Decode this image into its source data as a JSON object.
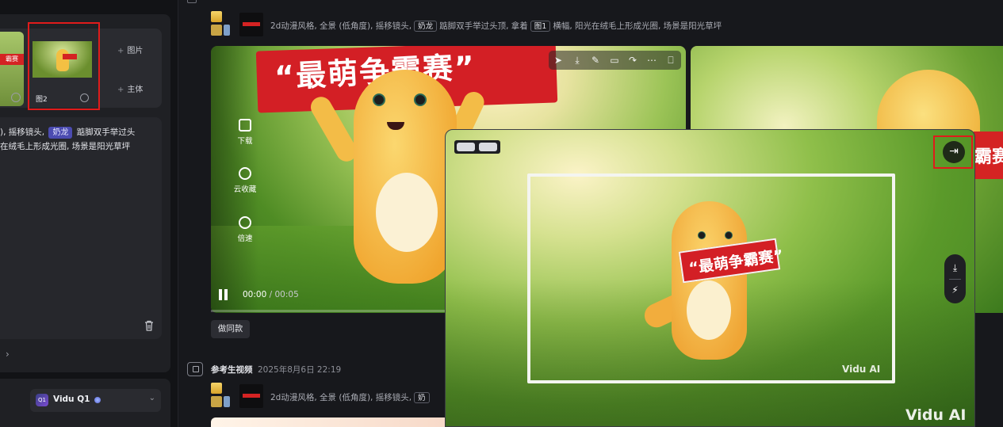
{
  "left_panel": {
    "thumb1_banner": "霸赛",
    "thumb2_label": "图2",
    "add_image_label": "图片",
    "add_subject_label": "主体",
    "prompt_line1_pre": "), 摇移镜头,",
    "prompt_tag": "奶龙",
    "prompt_line1_post": "踮脚双手举过头",
    "prompt_line2": "在绒毛上形成光圈, 场景是阳光草坪",
    "model_label": "Vidu Q1",
    "model_logo": "Q1"
  },
  "feed": {
    "prompt_pre": "2d动漫风格, 全景 (低角度), 摇移镜头,",
    "prompt_chip1": "奶龙",
    "prompt_mid": "踮脚双手举过头顶, 拿着",
    "prompt_chip2": "图1",
    "prompt_post": "横幅, 阳光在绒毛上形成光圈, 场景是阳光草坪",
    "video": {
      "banner_text": "“最萌争霸赛”",
      "actions": [
        "下载",
        "云收藏",
        "倍速"
      ],
      "time_current": "00:00",
      "time_separator": "/",
      "time_total": "00:05",
      "progress": 0
    },
    "same_style_button": "做同款",
    "section2_title": "参考生视频",
    "section2_date": "2025年8月6日 22:19",
    "section2_prompt_pre": "2d动漫风格, 全景 (低角度), 摇移镜头,",
    "section2_prompt_chip": "奶"
  },
  "preview_overlay": {
    "sign_text": "“最萌争霸赛”",
    "watermark_small": "Vidu AI",
    "watermark_large": "Vidu AI",
    "exit_icon_glyph": "⇥",
    "download_icon_glyph": "⤓",
    "magic_icon_glyph": "⚡"
  },
  "second_card_banner_text": "霸赛",
  "toolbar_icons": [
    "send-icon",
    "download-icon",
    "edit-icon",
    "expand-icon",
    "share-icon",
    "more-icon",
    "bookmark-icon"
  ],
  "colors": {
    "highlight_red": "#e01b1b",
    "banner_red": "#d31f25",
    "tag_purple": "#4b4bb0"
  }
}
